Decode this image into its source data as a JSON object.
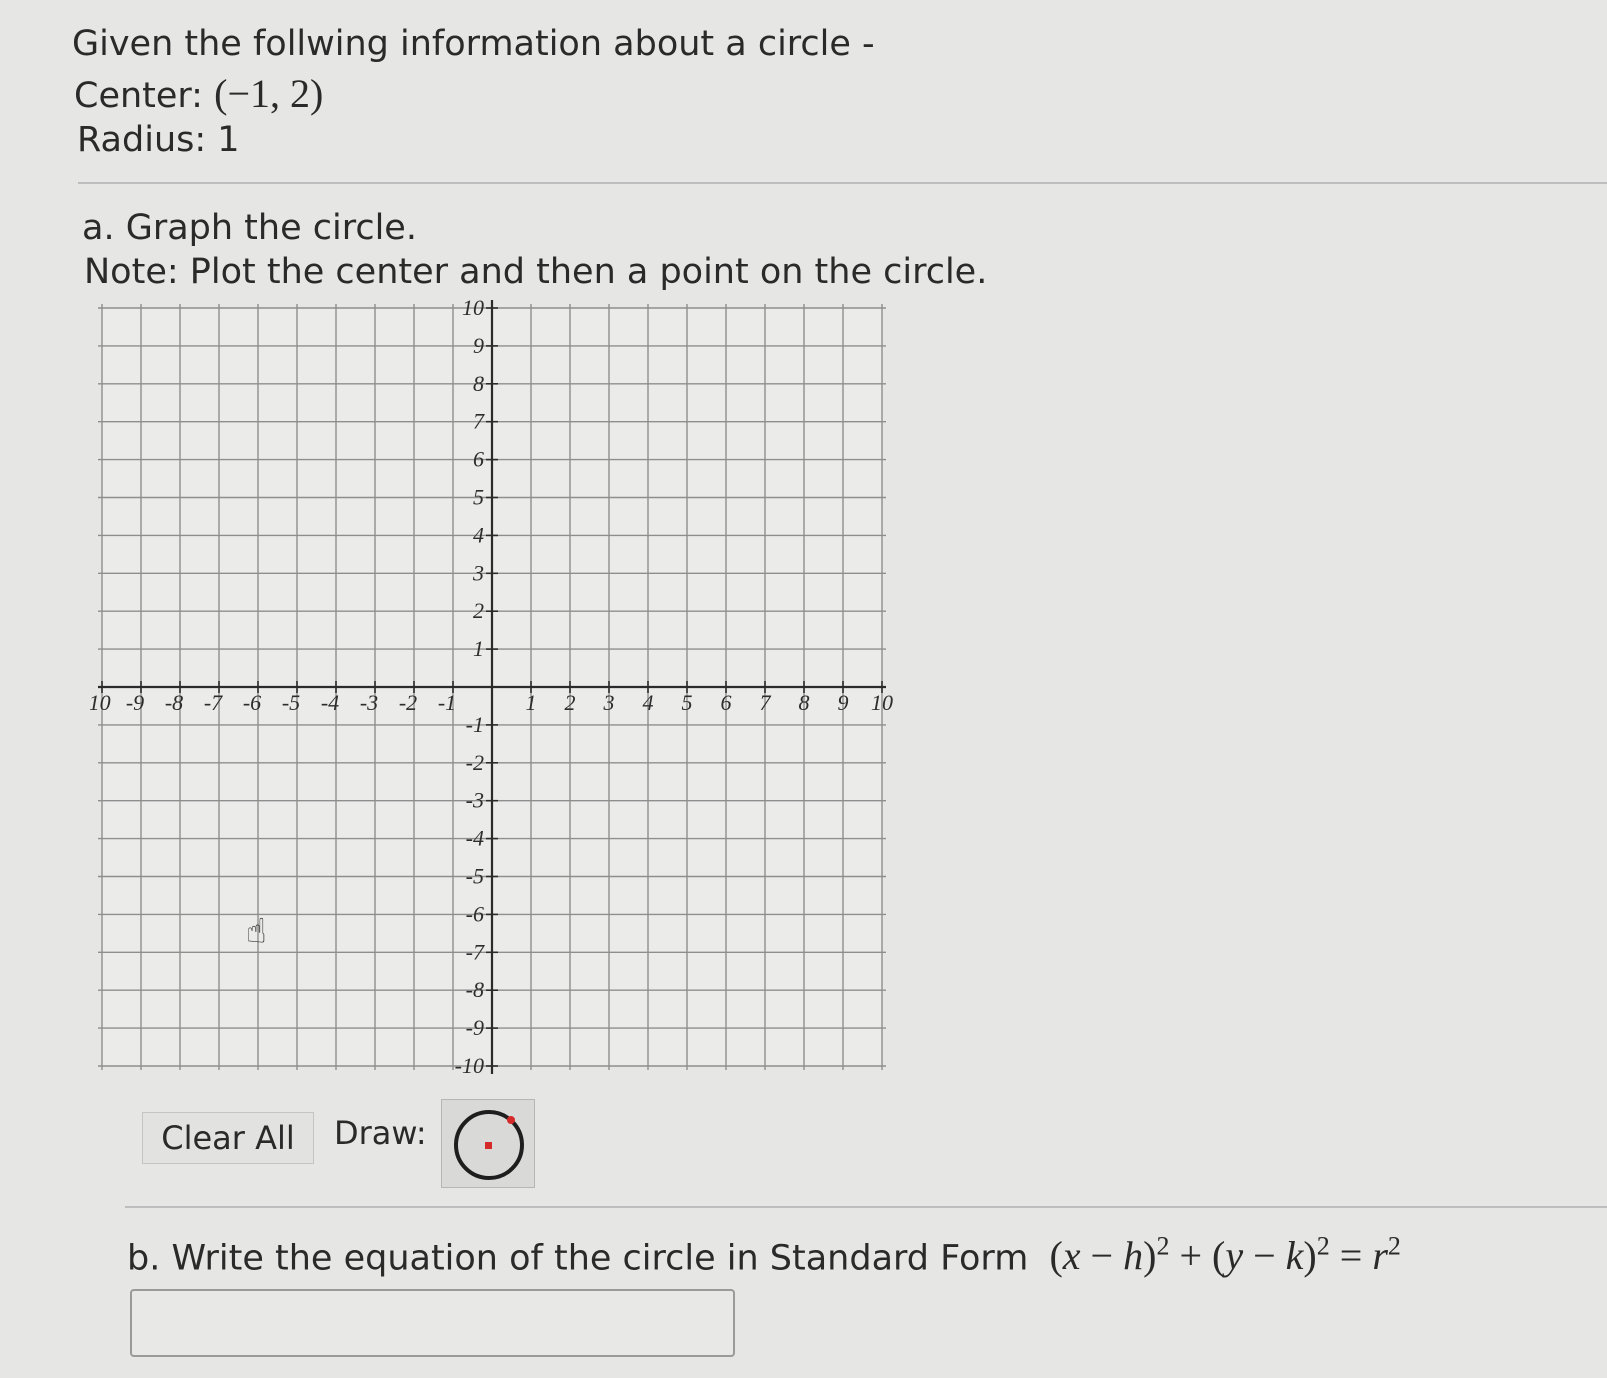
{
  "given": {
    "intro": "Given the follwing information about a circle -",
    "center_label": "Center:",
    "center_value": "(−1, 2)",
    "radius_label": "Radius:",
    "radius_value": "1"
  },
  "part_a": {
    "title": "a. Graph the circle.",
    "note": "Note: Plot the center and then a point on the circle."
  },
  "graph": {
    "x_range": [
      -10,
      10
    ],
    "y_range": [
      -10,
      10
    ],
    "grid_step": 1,
    "grid": true
  },
  "controls": {
    "clear_all": "Clear All",
    "draw_label": "Draw:",
    "draw_tool_icon": "circle-tool-icon"
  },
  "part_b": {
    "prefix": "b. Write the equation of the circle in Standard Form",
    "answer_value": ""
  },
  "colors": {
    "background": "#e6e6e4",
    "tool_accent": "#d42a2a"
  }
}
